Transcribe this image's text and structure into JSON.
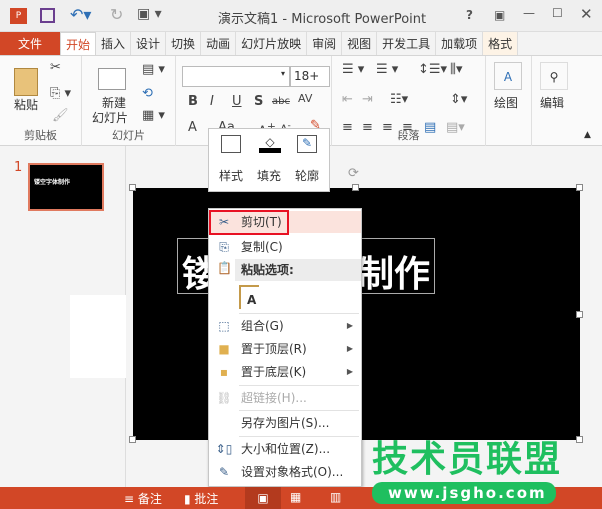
{
  "title": "演示文稿1 - Microsoft PowerPoint",
  "window_controls": {
    "help": "?"
  },
  "tabs": [
    "文件",
    "开始",
    "插入",
    "设计",
    "切换",
    "动画",
    "幻灯片放映",
    "审阅",
    "视图",
    "开发工具",
    "加载项",
    "格式"
  ],
  "ribbon": {
    "paste": "粘贴",
    "clipboard": "剪贴板",
    "new_slide_1": "新建",
    "new_slide_2": "幻灯片",
    "slides": "幻灯片",
    "font_size": "18+",
    "bold": "B",
    "italic": "I",
    "underline": "U",
    "shadow": "S",
    "strike": "abc",
    "spacing": "AV",
    "font_color": "A",
    "case": "Aa",
    "paragraph": "段落",
    "draw": "绘图",
    "edit": "编辑"
  },
  "mini_toolbar": {
    "style": "样式",
    "fill": "填充",
    "outline": "轮廓"
  },
  "slide_number": "1",
  "thumbnail_text": "镂空字体制作",
  "slide_text_left": "镂",
  "slide_text_right": "制作",
  "context_menu": {
    "cut": "剪切(T)",
    "copy": "复制(C)",
    "paste_options": "粘贴选项:",
    "paste_keep_text": "A",
    "group": "组合(G)",
    "bring_front": "置于顶层(R)",
    "send_back": "置于底层(K)",
    "hyperlink": "超链接(H)...",
    "save_as_picture": "另存为图片(S)...",
    "size_position": "大小和位置(Z)...",
    "format_object": "设置对象格式(O)..."
  },
  "status": {
    "notes": "备注",
    "comments": "批注"
  },
  "watermark": {
    "name": "技术员联盟",
    "url": "www.jsgho.com"
  },
  "colors": {
    "accent": "#d24726",
    "highlight": "#e81123",
    "watermark": "#1fbf5f"
  }
}
